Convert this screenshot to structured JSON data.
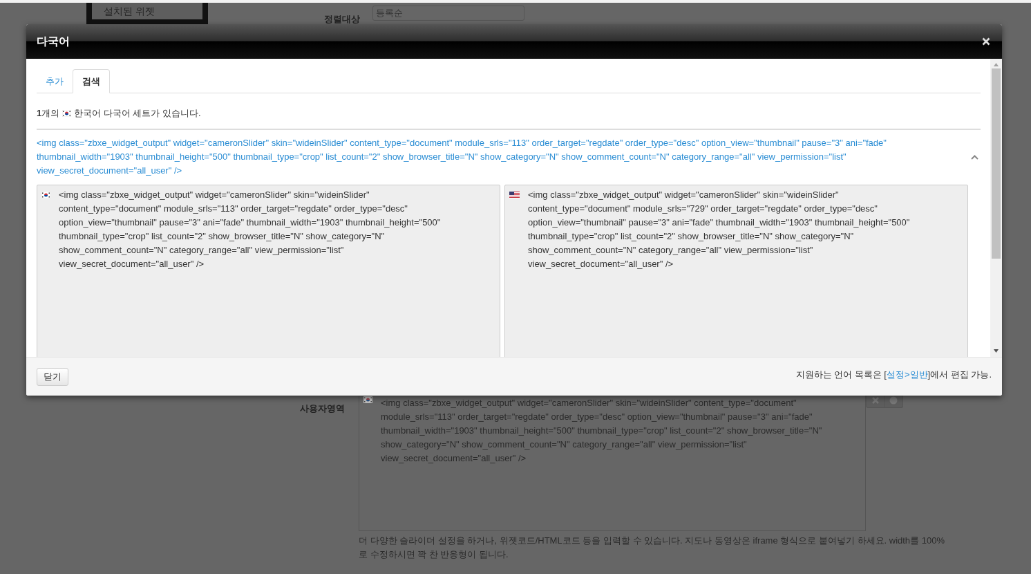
{
  "background_page": {
    "sidebar": {
      "items": [
        {
          "label": "설치된 위젯"
        }
      ]
    },
    "sort_field": {
      "label": "정렬대상",
      "value": "등록순"
    },
    "user_area": {
      "label": "사용자영역",
      "flag": {
        "kind": "korea"
      },
      "lines": [
        "<img class=\"zbxe_widget_output\" widget=\"cameronSlider\" skin=\"wideinSlider\" content_type=\"document\"",
        "module_srls=\"113\" order_target=\"regdate\" order_type=\"desc\" option_view=\"thumbnail\" pause=\"3\" ani=\"fade\"",
        "thumbnail_width=\"1903\" thumbnail_height=\"500\" thumbnail_type=\"crop\" list_count=\"2\" show_browser_title=\"N\"",
        "show_category=\"N\" show_comment_count=\"N\" category_range=\"all\" view_permission=\"list\"",
        "view_secret_document=\"all_user\" />"
      ]
    },
    "help_text": [
      "더 다양한 슬라이더 설정을 하거나, 위젯코드/HTML코드 등을 입력할 수 있습니다. 지도나 동영상은 iframe 형식으로 붙여넣기 하세요. width를 100%",
      "로 수정하시면 꽉 찬 반응형이 됩니다."
    ]
  },
  "dialog": {
    "title": "다국어",
    "tabs": [
      {
        "label": "추가",
        "selected": false
      },
      {
        "label": "검색",
        "selected": true
      }
    ],
    "summary": {
      "count": "**1**개의",
      "flag": {
        "kind": "korea"
      },
      "text": "한국어 다국어 세트가 있습니다."
    },
    "entries": [
      {
        "expanded": true,
        "source_lines": [
          "<img class=\"zbxe_widget_output\" widget=\"cameronSlider\" skin=\"wideinSlider\" content_type=\"document\" module_srls=\"113\" order_target=\"regdate\" order_type=\"desc\" option_view=\"thumbnail\" pause=\"3\" ani=\"fade\"",
          "thumbnail_width=\"1903\" thumbnail_height=\"500\" thumbnail_type=\"crop\" list_count=\"2\" show_browser_title=\"N\" show_category=\"N\" show_comment_count=\"N\" category_range=\"all\" view_permission=\"list\"",
          "view_secret_document=\"all_user\" />"
        ],
        "translations": [
          {
            "flag": {
              "kind": "korea"
            },
            "lines": [
              "<img class=\"zbxe_widget_output\" widget=\"cameronSlider\" skin=\"wideinSlider\"",
              "content_type=\"document\" module_srls=\"113\" order_target=\"regdate\" order_type=\"desc\"",
              "option_view=\"thumbnail\" pause=\"3\" ani=\"fade\" thumbnail_width=\"1903\" thumbnail_height=\"500\"",
              "thumbnail_type=\"crop\" list_count=\"2\" show_browser_title=\"N\" show_category=\"N\"",
              "show_comment_count=\"N\" category_range=\"all\" view_permission=\"list\"",
              "view_secret_document=\"all_user\" />"
            ]
          },
          {
            "flag": {
              "kind": "usa"
            },
            "lines": [
              "<img class=\"zbxe_widget_output\" widget=\"cameronSlider\" skin=\"wideinSlider\"",
              "content_type=\"document\" module_srls=\"729\" order_target=\"regdate\" order_type=\"desc\"",
              "option_view=\"thumbnail\" pause=\"3\" ani=\"fade\" thumbnail_width=\"1903\" thumbnail_height=\"500\"",
              "thumbnail_type=\"crop\" list_count=\"2\" show_browser_title=\"N\" show_category=\"N\"",
              "show_comment_count=\"N\" category_range=\"all\" view_permission=\"list\"",
              "view_secret_document=\"all_user\" />"
            ]
          }
        ]
      }
    ],
    "close_button": "닫기",
    "footer_note": {
      "before": "지원하는 언어 목록은 [",
      "link": "설정>일반",
      "after": "]에서 편집 가능."
    }
  }
}
